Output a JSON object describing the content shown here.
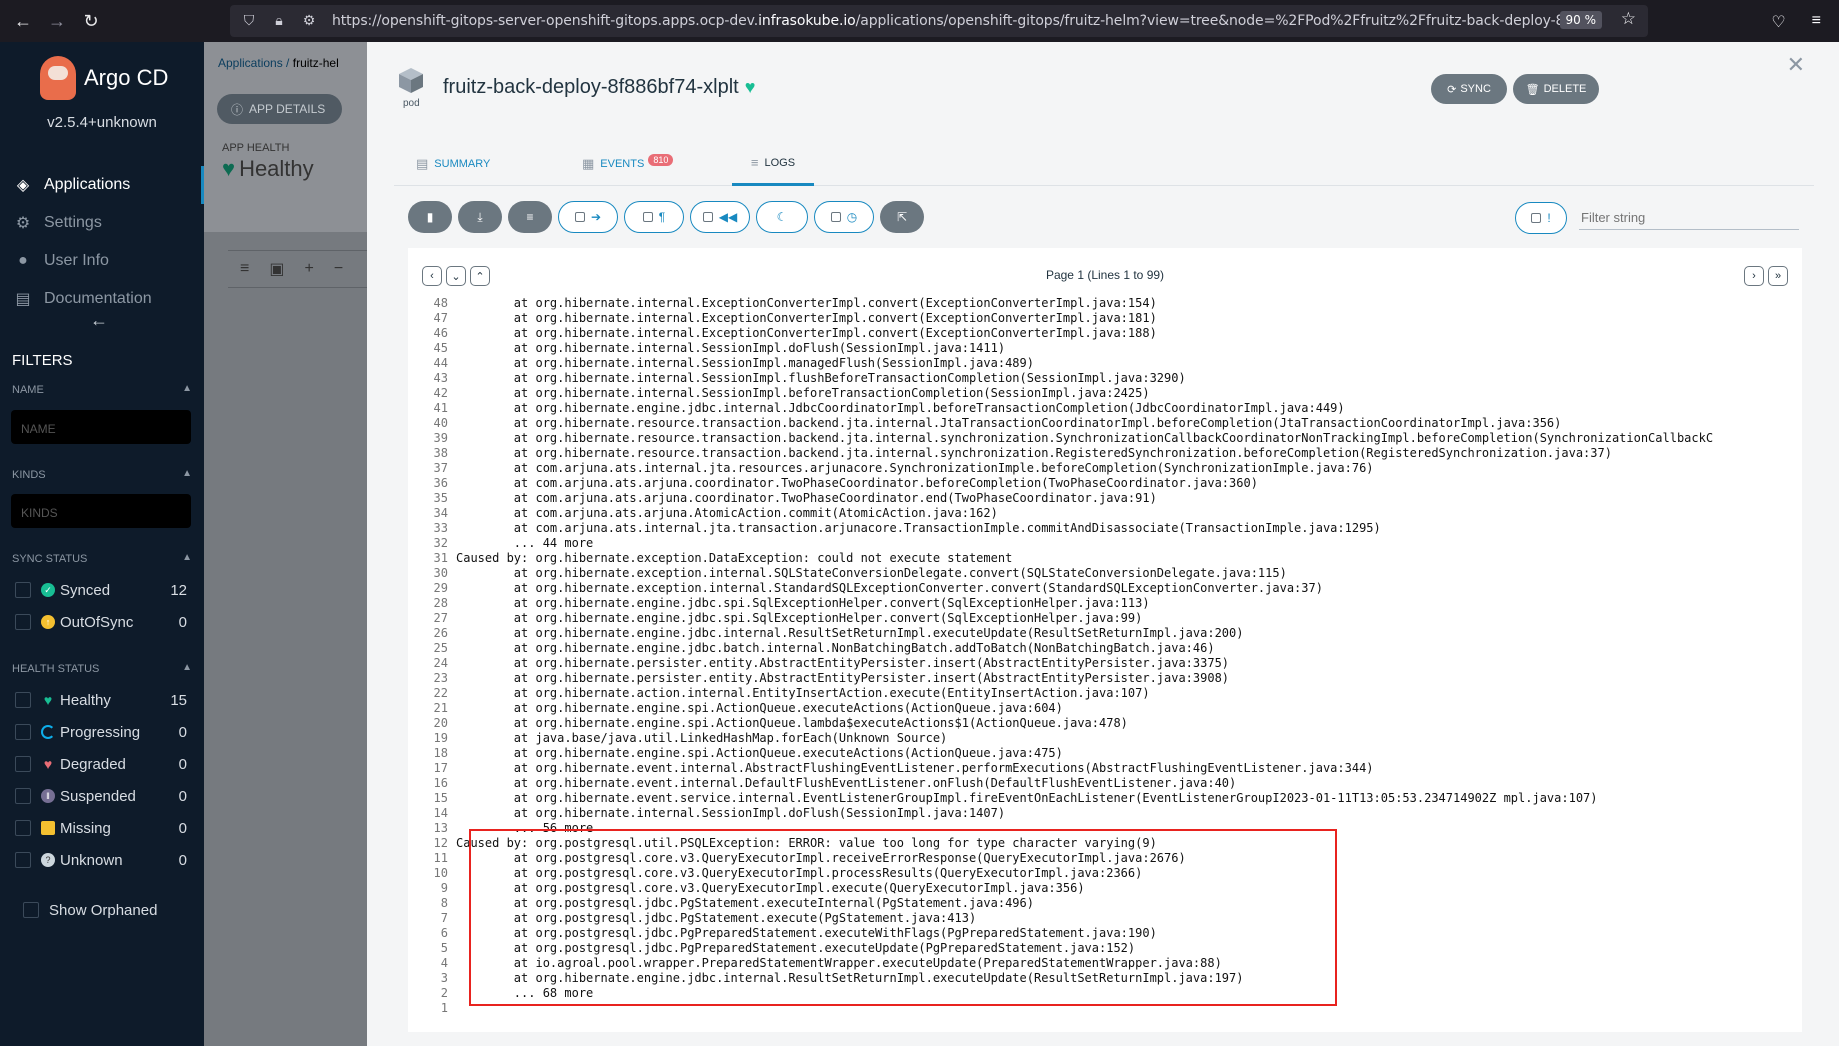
{
  "browser": {
    "url_prefix": "https://openshift-gitops-server-openshift-gitops.apps.ocp-dev.",
    "url_domain": "infrasokube.io",
    "url_suffix": "/applications/openshift-gitops/fruitz-helm?view=tree&node=%2FPod%2Ffruitz%2Ffruitz-back-deploy-8f886bf74-",
    "zoom": "90 %"
  },
  "sidebar": {
    "app_name": "Argo CD",
    "version": "v2.5.4+unknown",
    "nav": [
      {
        "label": "Applications",
        "icon": "layers-icon"
      },
      {
        "label": "Settings",
        "icon": "gears-icon"
      },
      {
        "label": "User Info",
        "icon": "user-icon"
      },
      {
        "label": "Documentation",
        "icon": "book-icon"
      }
    ],
    "filters_title": "FILTERS",
    "name_label": "NAME",
    "name_placeholder": "NAME",
    "kinds_label": "KINDS",
    "kinds_placeholder": "KINDS",
    "sync_status_label": "SYNC STATUS",
    "sync_status": [
      {
        "label": "Synced",
        "count": "12",
        "color": "#18be94"
      },
      {
        "label": "OutOfSync",
        "count": "0",
        "color": "#f4c030"
      }
    ],
    "health_status_label": "HEALTH STATUS",
    "health_status": [
      {
        "label": "Healthy",
        "count": "15",
        "color": "#18be94"
      },
      {
        "label": "Progressing",
        "count": "0",
        "color": "#0dadea"
      },
      {
        "label": "Degraded",
        "count": "0",
        "color": "#e96d76"
      },
      {
        "label": "Suspended",
        "count": "0",
        "color": "#766f94"
      },
      {
        "label": "Missing",
        "count": "0",
        "color": "#f4c030"
      },
      {
        "label": "Unknown",
        "count": "0",
        "color": "#ccd6dd"
      }
    ],
    "show_orphaned": "Show Orphaned"
  },
  "app_bg": {
    "breadcrumb": "Applications",
    "breadcrumb_current": "fruitz-hel",
    "app_details_btn": "APP DETAILS",
    "app_health_label": "APP HEALTH",
    "app_health_value": "Healthy"
  },
  "panel": {
    "kind": "pod",
    "title": "fruitz-back-deploy-8f886bf74-xlplt",
    "sync_btn": "SYNC",
    "delete_btn": "DELETE",
    "tabs": [
      {
        "label": "SUMMARY"
      },
      {
        "label": "EVENTS",
        "badge": "810"
      },
      {
        "label": "LOGS"
      }
    ],
    "filter_placeholder": "Filter string",
    "page_info": "Page 1 (Lines 1 to 99)"
  },
  "logs": [
    {
      "n": "48",
      "t": "        at org.hibernate.internal.ExceptionConverterImpl.convert(ExceptionConverterImpl.java:154)"
    },
    {
      "n": "47",
      "t": "        at org.hibernate.internal.ExceptionConverterImpl.convert(ExceptionConverterImpl.java:181)"
    },
    {
      "n": "46",
      "t": "        at org.hibernate.internal.ExceptionConverterImpl.convert(ExceptionConverterImpl.java:188)"
    },
    {
      "n": "45",
      "t": "        at org.hibernate.internal.SessionImpl.doFlush(SessionImpl.java:1411)"
    },
    {
      "n": "44",
      "t": "        at org.hibernate.internal.SessionImpl.managedFlush(SessionImpl.java:489)"
    },
    {
      "n": "43",
      "t": "        at org.hibernate.internal.SessionImpl.flushBeforeTransactionCompletion(SessionImpl.java:3290)"
    },
    {
      "n": "42",
      "t": "        at org.hibernate.internal.SessionImpl.beforeTransactionCompletion(SessionImpl.java:2425)"
    },
    {
      "n": "41",
      "t": "        at org.hibernate.engine.jdbc.internal.JdbcCoordinatorImpl.beforeTransactionCompletion(JdbcCoordinatorImpl.java:449)"
    },
    {
      "n": "40",
      "t": "        at org.hibernate.resource.transaction.backend.jta.internal.JtaTransactionCoordinatorImpl.beforeCompletion(JtaTransactionCoordinatorImpl.java:356)"
    },
    {
      "n": "39",
      "t": "        at org.hibernate.resource.transaction.backend.jta.internal.synchronization.SynchronizationCallbackCoordinatorNonTrackingImpl.beforeCompletion(SynchronizationCallbackC"
    },
    {
      "n": "38",
      "t": "        at org.hibernate.resource.transaction.backend.jta.internal.synchronization.RegisteredSynchronization.beforeCompletion(RegisteredSynchronization.java:37)"
    },
    {
      "n": "37",
      "t": "        at com.arjuna.ats.internal.jta.resources.arjunacore.SynchronizationImple.beforeCompletion(SynchronizationImple.java:76)"
    },
    {
      "n": "36",
      "t": "        at com.arjuna.ats.arjuna.coordinator.TwoPhaseCoordinator.beforeCompletion(TwoPhaseCoordinator.java:360)"
    },
    {
      "n": "35",
      "t": "        at com.arjuna.ats.arjuna.coordinator.TwoPhaseCoordinator.end(TwoPhaseCoordinator.java:91)"
    },
    {
      "n": "34",
      "t": "        at com.arjuna.ats.arjuna.AtomicAction.commit(AtomicAction.java:162)"
    },
    {
      "n": "33",
      "t": "        at com.arjuna.ats.internal.jta.transaction.arjunacore.TransactionImple.commitAndDisassociate(TransactionImple.java:1295)"
    },
    {
      "n": "32",
      "t": "        ... 44 more"
    },
    {
      "n": "31",
      "t": "Caused by: org.hibernate.exception.DataException: could not execute statement"
    },
    {
      "n": "30",
      "t": "        at org.hibernate.exception.internal.SQLStateConversionDelegate.convert(SQLStateConversionDelegate.java:115)"
    },
    {
      "n": "29",
      "t": "        at org.hibernate.exception.internal.StandardSQLExceptionConverter.convert(StandardSQLExceptionConverter.java:37)"
    },
    {
      "n": "28",
      "t": "        at org.hibernate.engine.jdbc.spi.SqlExceptionHelper.convert(SqlExceptionHelper.java:113)"
    },
    {
      "n": "27",
      "t": "        at org.hibernate.engine.jdbc.spi.SqlExceptionHelper.convert(SqlExceptionHelper.java:99)"
    },
    {
      "n": "26",
      "t": "        at org.hibernate.engine.jdbc.internal.ResultSetReturnImpl.executeUpdate(ResultSetReturnImpl.java:200)"
    },
    {
      "n": "25",
      "t": "        at org.hibernate.engine.jdbc.batch.internal.NonBatchingBatch.addToBatch(NonBatchingBatch.java:46)"
    },
    {
      "n": "24",
      "t": "        at org.hibernate.persister.entity.AbstractEntityPersister.insert(AbstractEntityPersister.java:3375)"
    },
    {
      "n": "23",
      "t": "        at org.hibernate.persister.entity.AbstractEntityPersister.insert(AbstractEntityPersister.java:3908)"
    },
    {
      "n": "22",
      "t": "        at org.hibernate.action.internal.EntityInsertAction.execute(EntityInsertAction.java:107)"
    },
    {
      "n": "21",
      "t": "        at org.hibernate.engine.spi.ActionQueue.executeActions(ActionQueue.java:604)"
    },
    {
      "n": "20",
      "t": "        at org.hibernate.engine.spi.ActionQueue.lambda$executeActions$1(ActionQueue.java:478)"
    },
    {
      "n": "19",
      "t": "        at java.base/java.util.LinkedHashMap.forEach(Unknown Source)"
    },
    {
      "n": "18",
      "t": "        at org.hibernate.engine.spi.ActionQueue.executeActions(ActionQueue.java:475)"
    },
    {
      "n": "17",
      "t": "        at org.hibernate.event.internal.AbstractFlushingEventListener.performExecutions(AbstractFlushingEventListener.java:344)"
    },
    {
      "n": "16",
      "t": "        at org.hibernate.event.internal.DefaultFlushEventListener.onFlush(DefaultFlushEventListener.java:40)"
    },
    {
      "n": "15",
      "t": "        at org.hibernate.event.service.internal.EventListenerGroupImpl.fireEventOnEachListener(EventListenerGroupI2023-01-11T13:05:53.234714902Z mpl.java:107)"
    },
    {
      "n": "14",
      "t": "        at org.hibernate.internal.SessionImpl.doFlush(SessionImpl.java:1407)"
    },
    {
      "n": "13",
      "t": "        ... 56 more"
    },
    {
      "n": "12",
      "t": "Caused by: org.postgresql.util.PSQLException: ERROR: value too long for type character varying(9)"
    },
    {
      "n": "11",
      "t": "        at org.postgresql.core.v3.QueryExecutorImpl.receiveErrorResponse(QueryExecutorImpl.java:2676)"
    },
    {
      "n": "10",
      "t": "        at org.postgresql.core.v3.QueryExecutorImpl.processResults(QueryExecutorImpl.java:2366)"
    },
    {
      "n": "9",
      "t": "        at org.postgresql.core.v3.QueryExecutorImpl.execute(QueryExecutorImpl.java:356)"
    },
    {
      "n": "8",
      "t": "        at org.postgresql.jdbc.PgStatement.executeInternal(PgStatement.java:496)"
    },
    {
      "n": "7",
      "t": "        at org.postgresql.jdbc.PgStatement.execute(PgStatement.java:413)"
    },
    {
      "n": "6",
      "t": "        at org.postgresql.jdbc.PgPreparedStatement.executeWithFlags(PgPreparedStatement.java:190)"
    },
    {
      "n": "5",
      "t": "        at org.postgresql.jdbc.PgPreparedStatement.executeUpdate(PgPreparedStatement.java:152)"
    },
    {
      "n": "4",
      "t": "        at io.agroal.pool.wrapper.PreparedStatementWrapper.executeUpdate(PreparedStatementWrapper.java:88)"
    },
    {
      "n": "3",
      "t": "        at org.hibernate.engine.jdbc.internal.ResultSetReturnImpl.executeUpdate(ResultSetReturnImpl.java:197)"
    },
    {
      "n": "2",
      "t": "        ... 68 more"
    },
    {
      "n": "1",
      "t": ""
    }
  ]
}
